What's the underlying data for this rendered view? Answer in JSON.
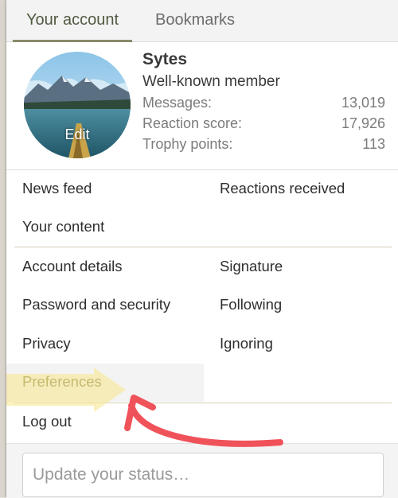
{
  "tabs": [
    {
      "label": "Your account"
    },
    {
      "label": "Bookmarks"
    }
  ],
  "profile": {
    "avatar_edit_label": "Edit",
    "username": "Sytes",
    "user_title": "Well-known member",
    "stats": [
      {
        "label": "Messages:",
        "value": "13,019"
      },
      {
        "label": "Reaction score:",
        "value": "17,926"
      },
      {
        "label": "Trophy points:",
        "value": "113"
      }
    ]
  },
  "links": {
    "news_feed": "News feed",
    "reactions_received": "Reactions received",
    "your_content": "Your content",
    "account_details": "Account details",
    "signature": "Signature",
    "password_security": "Password and security",
    "following": "Following",
    "privacy": "Privacy",
    "ignoring": "Ignoring",
    "preferences": "Preferences",
    "log_out": "Log out"
  },
  "status": {
    "placeholder": "Update your status…"
  },
  "colors": {
    "active_tab": "#4f5a41",
    "highlight_link": "#8a844e",
    "annotation_arrow": "#f0525a",
    "annotation_marker": "#f7e68a"
  }
}
